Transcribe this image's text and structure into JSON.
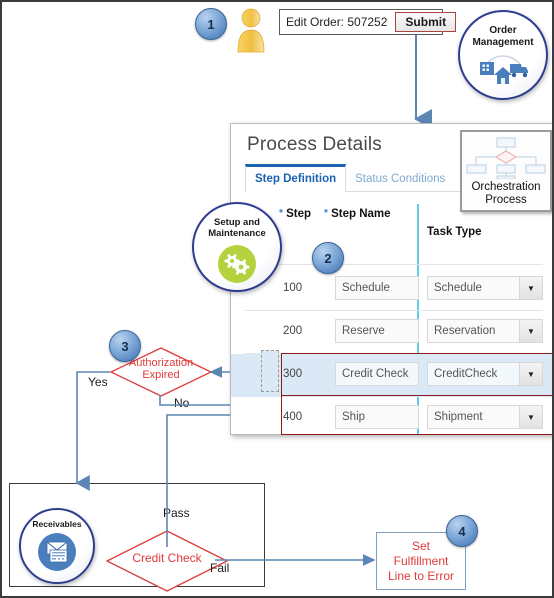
{
  "top": {
    "badge1": "1",
    "user_icon": "person-icon",
    "edit_order_label": "Edit Order: 507252",
    "submit_label": "Submit",
    "order_management": {
      "title_line1": "Order",
      "title_line2": "Management",
      "icon": "order-management-icon"
    }
  },
  "panel": {
    "title": "Process Details",
    "tabs": [
      {
        "label": "Step Definition",
        "active": true
      },
      {
        "label": "Status Conditions",
        "active": false
      }
    ],
    "orchestration_thumb": {
      "label_line1": "Orchestration",
      "label_line2": "Process",
      "icon": "orchestration-process-icon"
    },
    "badge2": "2",
    "columns": {
      "step": "Step",
      "step_name": "Step Name",
      "task_type": "Task Type",
      "required_marker": "*"
    },
    "rows": [
      {
        "step": "100",
        "step_name": "Schedule",
        "task_type": "Schedule",
        "highlight": false
      },
      {
        "step": "200",
        "step_name": "Reserve",
        "task_type": "Reservation",
        "highlight": false
      },
      {
        "step": "300",
        "step_name": "Credit Check",
        "task_type": "CreditCheck",
        "highlight": true
      },
      {
        "step": "400",
        "step_name": "Ship",
        "task_type": "Shipment",
        "highlight": false
      }
    ],
    "dropdown_glyph": "▼"
  },
  "setup": {
    "title_line1": "Setup and",
    "title_line2": "Maintenance",
    "icon": "gears-icon"
  },
  "auth": {
    "badge3": "3",
    "label_line1": "Authorization",
    "label_line2": "Expired",
    "yes_label": "Yes",
    "no_label": "No"
  },
  "receivables": {
    "title": "Receivables",
    "icon": "receivables-envelope-icon",
    "decision_label": "Credit Check",
    "pass_label": "Pass",
    "fail_label": "Fail"
  },
  "error_action": {
    "badge4": "4",
    "line1": "Set",
    "line2": "Fulfillment",
    "line3": "Line to Error"
  },
  "colors": {
    "accent_blue": "#1a64b0",
    "connector_blue": "#5c87b5",
    "red_text": "#e03a3a",
    "row_highlight": "#dbe9f7",
    "red_border": "#8f1a1a",
    "cyan_rule": "#63cbe8",
    "pillar_ring": "#2d3c8f"
  }
}
